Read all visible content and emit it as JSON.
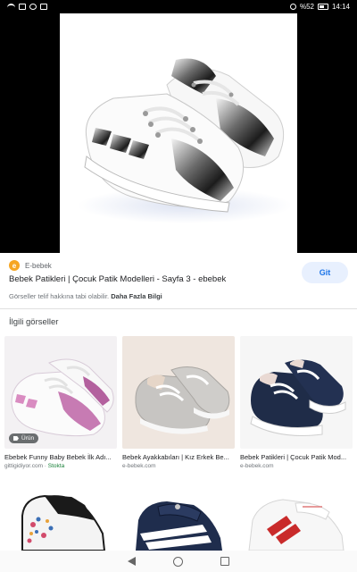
{
  "status_bar": {
    "battery": "%52",
    "time": "14:14"
  },
  "source": {
    "site": "E-bebek",
    "logo_letter": "e",
    "title": "Bebek Patikleri | Çocuk Patik Modelleri - Sayfa 3 - ebebek",
    "visit_label": "Git",
    "copyright": "Görseller telif hakkına tabi olabilir.",
    "more_info": "Daha Fazla Bilgi"
  },
  "related": {
    "heading": "İlgili görseller",
    "items": [
      {
        "caption": "Ebebek Funny Baby Bebek İlk Adı...",
        "domain": "gittigidiyor.com",
        "stock": "Stokta",
        "badge": "Ürün"
      },
      {
        "caption": "Bebek Ayakkabıları | Kız Erkek Be...",
        "domain": "e-bebek.com"
      },
      {
        "caption": "Bebek Patikleri | Çocuk Patik Mod...",
        "domain": "e-bebek.com"
      },
      {
        "caption": "",
        "domain": ""
      },
      {
        "caption": "",
        "domain": ""
      },
      {
        "caption": "",
        "domain": ""
      }
    ]
  },
  "colors": {
    "accent": "#1a73e8",
    "stock": "#188038"
  }
}
